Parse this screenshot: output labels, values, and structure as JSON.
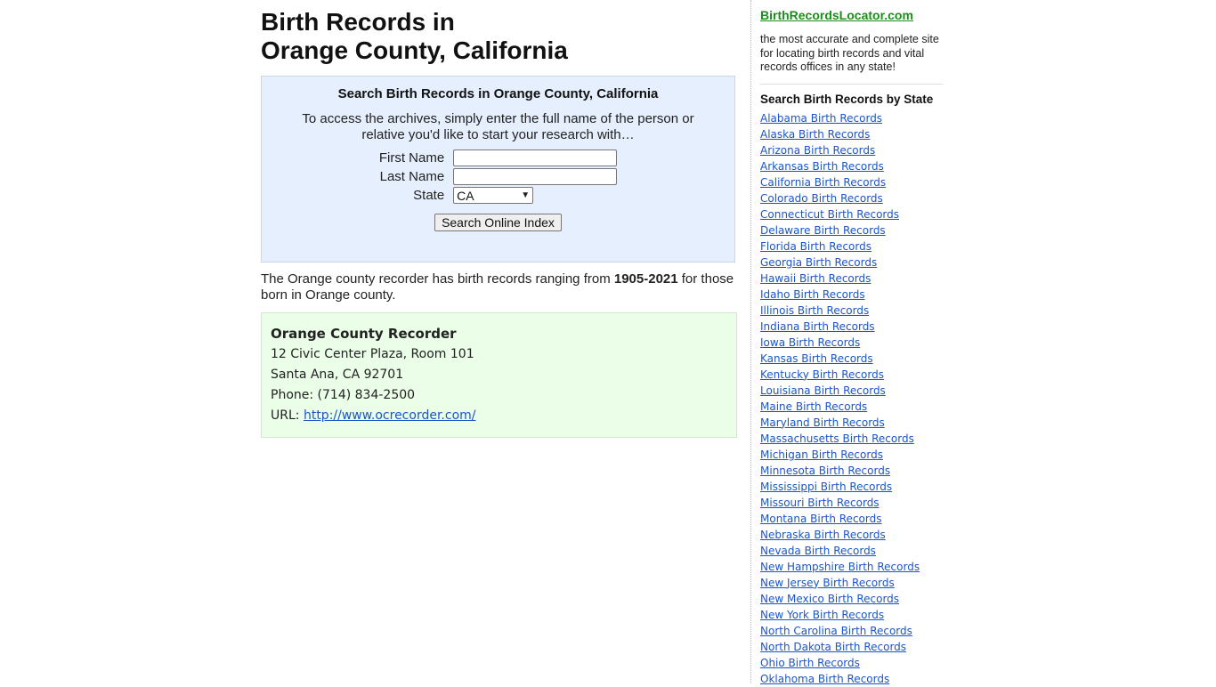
{
  "page": {
    "title_line1": "Birth Records in",
    "title_line2": "Orange County, California"
  },
  "search": {
    "heading": "Search Birth Records in Orange County, California",
    "intro": "To access the archives, simply enter the full name of the person or relative you'd like to start your research with…",
    "first_name_label": "First Name",
    "first_name_value": "",
    "last_name_label": "Last Name",
    "last_name_value": "",
    "state_label": "State",
    "state_selected": "CA",
    "submit_label": "Search Online Index"
  },
  "range": {
    "prefix": "The Orange county recorder has birth records ranging from ",
    "years": "1905-2021",
    "suffix": " for those born in Orange county."
  },
  "recorder": {
    "name": "Orange County Recorder",
    "address1": "12 Civic Center Plaza, Room 101",
    "address2": "Santa Ana, CA 92701",
    "phone_label": "Phone: ",
    "phone": "(714) 834-2500",
    "url_label": "URL: ",
    "url": "http://www.ocrecorder.com/"
  },
  "sidebar": {
    "site_name": "BirthRecordsLocator.com",
    "tagline": "the most accurate and complete site for locating birth records and vital records offices in any state!",
    "states_heading": "Search Birth Records by State",
    "states": [
      "Alabama Birth Records",
      "Alaska Birth Records",
      "Arizona Birth Records",
      "Arkansas Birth Records",
      "California Birth Records",
      "Colorado Birth Records",
      "Connecticut Birth Records",
      "Delaware Birth Records",
      "Florida Birth Records",
      "Georgia Birth Records",
      "Hawaii Birth Records",
      "Idaho Birth Records",
      "Illinois Birth Records",
      "Indiana Birth Records",
      "Iowa Birth Records",
      "Kansas Birth Records",
      "Kentucky Birth Records",
      "Louisiana Birth Records",
      "Maine Birth Records",
      "Maryland Birth Records",
      "Massachusetts Birth Records",
      "Michigan Birth Records",
      "Minnesota Birth Records",
      "Mississippi Birth Records",
      "Missouri Birth Records",
      "Montana Birth Records",
      "Nebraska Birth Records",
      "Nevada Birth Records",
      "New Hampshire Birth Records",
      "New Jersey Birth Records",
      "New Mexico Birth Records",
      "New York Birth Records",
      "North Carolina Birth Records",
      "North Dakota Birth Records",
      "Ohio Birth Records",
      "Oklahoma Birth Records"
    ]
  },
  "colors": {
    "search_bg": "#e6effd",
    "recorder_bg": "#eafee8",
    "link": "#1a56c7",
    "site_link": "#1d8b1d"
  }
}
